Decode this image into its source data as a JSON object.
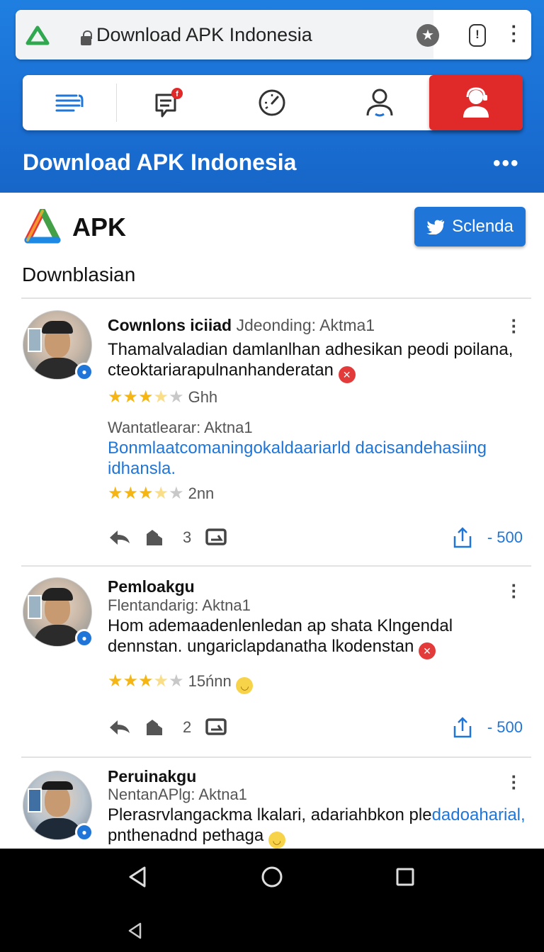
{
  "browser": {
    "url_text": "Download APK Indonesia",
    "star_glyph": "★",
    "info_glyph": "!",
    "menu_glyph": "⋮"
  },
  "tabs": [
    {
      "icon": "list-icon"
    },
    {
      "icon": "chat-notification-icon",
      "badge": "f"
    },
    {
      "icon": "speedometer-icon"
    },
    {
      "icon": "user-icon"
    },
    {
      "icon": "support-agent-icon",
      "active": true
    }
  ],
  "header": {
    "title": "Download APK Indonesia",
    "overflow": "•••"
  },
  "app": {
    "name": "APK",
    "share_label": "Sclenda",
    "section_title": "Downblasian"
  },
  "reviews": [
    {
      "name": "Cownlons iciiad",
      "name_suffix": "Jdeonding: Aktma1",
      "text": "Thamalvaladian damlanlhan adhesikan peodi poilana, cteoktariarapulnanhanderatan",
      "rating_label": "Ghh",
      "rating": 3.5,
      "meta": "Wantatlearar: Aktna1",
      "link_text": "Bonmlaatcomaningokaldaariarld dacisandehasiing idhansla.",
      "rating2_label": "2nn",
      "rating2": 3.5,
      "action_count": "3",
      "share_count": "- 500"
    },
    {
      "name": "Pemloakgu",
      "meta": "Flentandarig: Aktna1",
      "text": "Hom ademaadenlenledan ap shata Klngendal dennstan. ungariclapdanatha lkodenstan",
      "rating_label": "15ńnn",
      "rating": 3.5,
      "action_count": "2",
      "share_count": "- 500"
    },
    {
      "name": "Peruinakgu",
      "meta": "NentanAPlg: Aktna1",
      "text_plain": "Plerasrvlangackma lkalari, adariahbkon ple",
      "text_link": "dadoaharial,",
      "text_line2": "pnthenadnd pethaga"
    }
  ],
  "colors": {
    "header_blue": "#1a6fd4",
    "accent_red": "#e02a2a",
    "link_blue": "#1f75d8",
    "star": "#f5b514"
  }
}
